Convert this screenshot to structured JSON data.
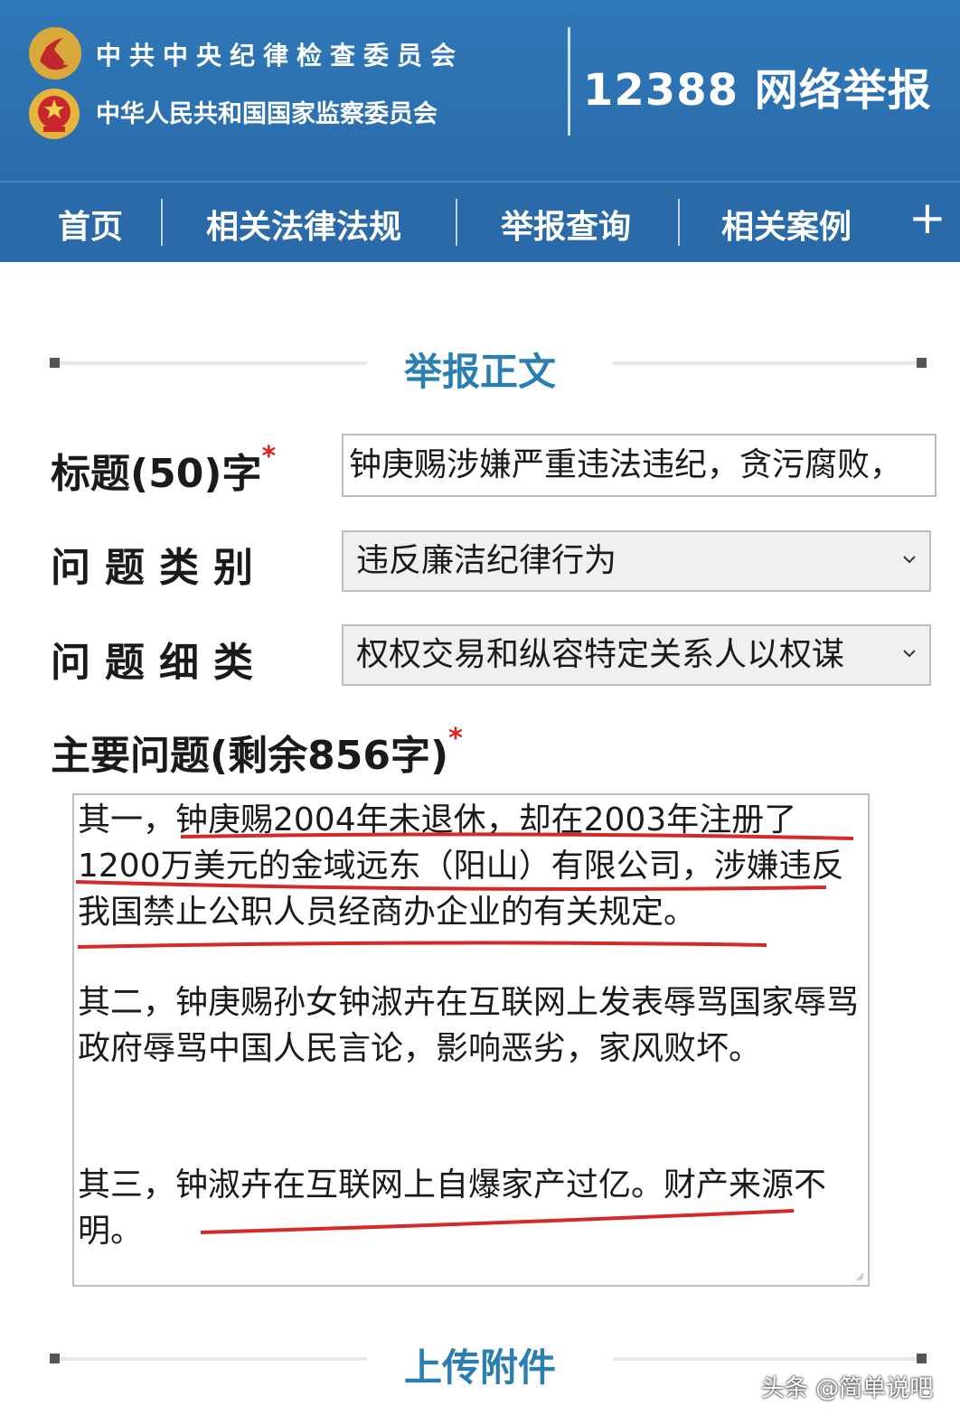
{
  "header": {
    "org_line_1": "中共中央纪律检查委员会",
    "org_line_2": "中华人民共和国国家监察委员会",
    "site_title": "12388 网络举报",
    "emblem_1": "party-emblem",
    "emblem_2": "national-emblem",
    "background_color": "#2f78b8"
  },
  "nav": {
    "items": [
      "首页",
      "相关法律法规",
      "举报查询",
      "相关案例"
    ],
    "more_icon": "plus-icon",
    "more_label": "+"
  },
  "sections": {
    "report_body_title": "举报正文",
    "attachments_title": "上传附件"
  },
  "form": {
    "title_label": "标题(50)字",
    "title_value": "钟庚赐涉嫌严重违法违纪，贪污腐败，",
    "category_label": "问题类别",
    "category_value": "违反廉洁纪律行为",
    "subcategory_label": "问题细类",
    "subcategory_value": "权权交易和纵容特定关系人以权谋",
    "main_issue_label": "主要问题(剩余856字)",
    "required_mark": "*",
    "main_issue_paragraphs": [
      "其一，钟庚赐2004年未退休，却在2003年注册了1200万美元的金域远东（阳山）有限公司，涉嫌违反我国禁止公职人员经商办企业的有关规定。",
      "其二，钟庚赐孙女钟淑卉在互联网上发表辱骂国家辱骂政府辱骂中国人民言论，影响恶劣，家风败坏。",
      "其三，钟淑卉在互联网上自爆家产过亿。财产来源不明。"
    ],
    "highlight_color": "#d42a2a"
  },
  "watermark": "头条 @简单说吧",
  "accent_color": "#2b7fb0"
}
